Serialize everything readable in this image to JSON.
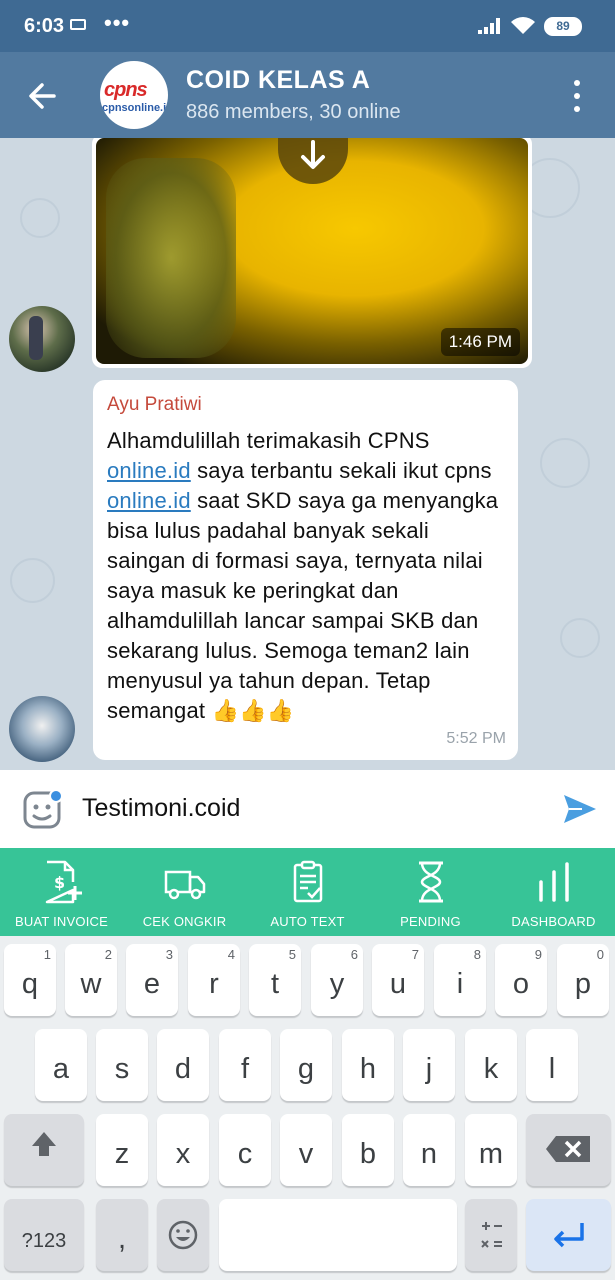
{
  "status_bar": {
    "time": "6:03",
    "dots": "•••",
    "battery": "89"
  },
  "header": {
    "title": "COID KELAS A",
    "subtitle": "886 members, 30 online",
    "logo_top": "cpns",
    "logo_sub": "cpnsonline.id"
  },
  "media_message": {
    "time": "1:46 PM"
  },
  "text_message": {
    "sender": "Ayu Pratiwi",
    "text_part1": "Alhamdulillah terimakasih CPNS ",
    "link1": "online.id",
    "text_part2": " saya terbantu sekali ikut cpns ",
    "link2": "online.id",
    "text_part3": " saat SKD saya ga menyangka bisa lulus padahal banyak sekali saingan di formasi saya, ternyata nilai saya masuk ke peringkat dan alhamdulillah lancar sampai SKB dan sekarang lulus. Semoga teman2 lain menyusul ya tahun depan. Tetap semangat ",
    "emoji": "👍👍👍",
    "time": "5:52 PM"
  },
  "input": {
    "value": "Testimoni.coid"
  },
  "toolbar": {
    "items": [
      {
        "label": "BUAT INVOICE",
        "icon": "invoice-icon"
      },
      {
        "label": "CEK ONGKIR",
        "icon": "truck-icon"
      },
      {
        "label": "AUTO TEXT",
        "icon": "clipboard-icon"
      },
      {
        "label": "PENDING",
        "icon": "hourglass-icon"
      },
      {
        "label": "DASHBOARD",
        "icon": "dashboard-icon"
      }
    ]
  },
  "keyboard": {
    "row1": [
      {
        "ch": "q",
        "hint": "1"
      },
      {
        "ch": "w",
        "hint": "2"
      },
      {
        "ch": "e",
        "hint": "3"
      },
      {
        "ch": "r",
        "hint": "4"
      },
      {
        "ch": "t",
        "hint": "5"
      },
      {
        "ch": "y",
        "hint": "6"
      },
      {
        "ch": "u",
        "hint": "7"
      },
      {
        "ch": "i",
        "hint": "8"
      },
      {
        "ch": "o",
        "hint": "9"
      },
      {
        "ch": "p",
        "hint": "0"
      }
    ],
    "row2": [
      "a",
      "s",
      "d",
      "f",
      "g",
      "h",
      "j",
      "k",
      "l"
    ],
    "row3": [
      "z",
      "x",
      "c",
      "v",
      "b",
      "n",
      "m"
    ],
    "symbols_label": "?123",
    "comma": ","
  },
  "colors": {
    "header": "#527aa0",
    "toolbar": "#37c497",
    "link": "#2a7bbf",
    "sender": "#c54a3c"
  }
}
